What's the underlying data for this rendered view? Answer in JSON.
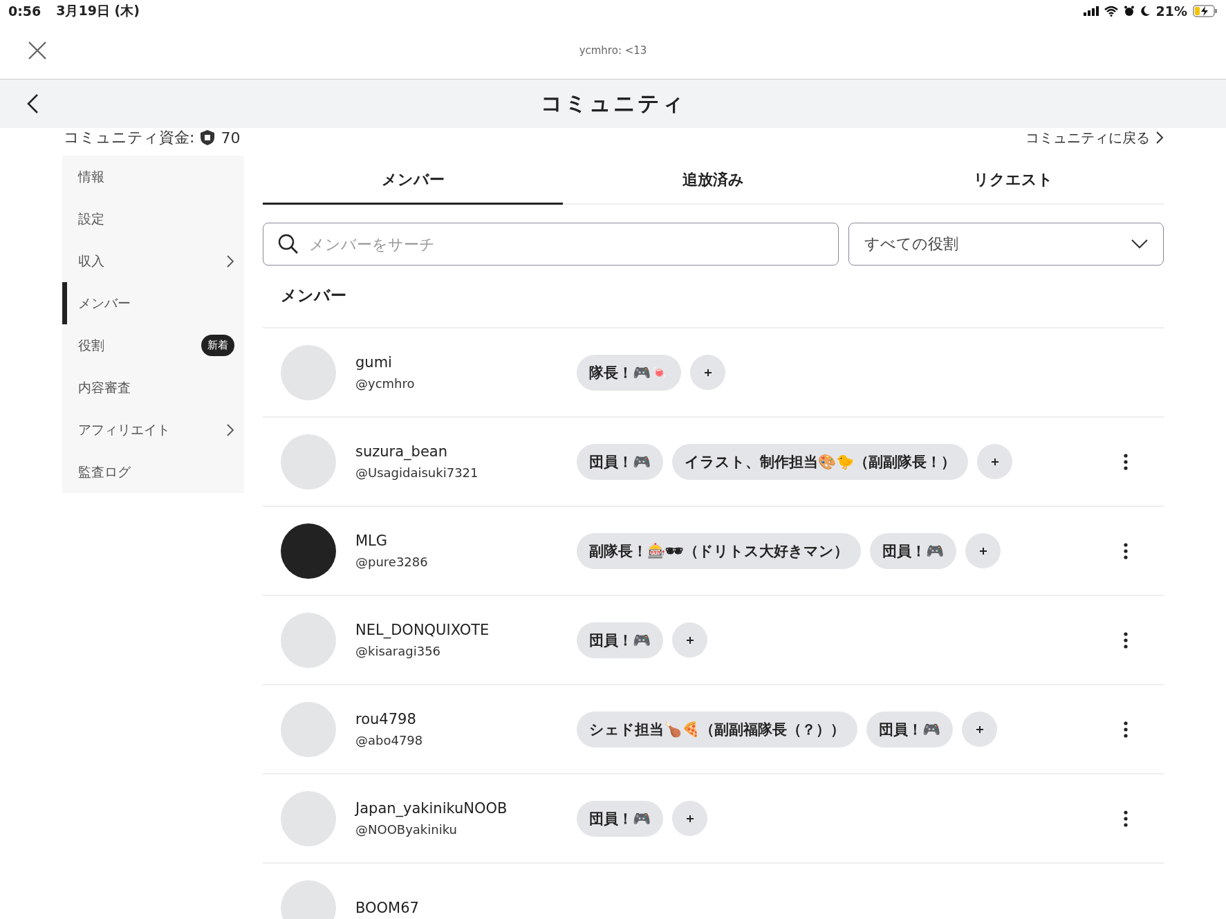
{
  "status_bar": {
    "time": "0:56",
    "date": "3月19日 (木)",
    "battery": "21%"
  },
  "top_bar": {
    "title": "ycmhro: <13"
  },
  "nav_bar": {
    "title": "コミュニティ"
  },
  "funds": {
    "label": "コミュニティ資金:",
    "amount": "70",
    "back_link": "コミュニティに戻る"
  },
  "sidebar": {
    "items": [
      {
        "label": "情報",
        "selected": false,
        "expandable": false
      },
      {
        "label": "設定",
        "selected": false,
        "expandable": false
      },
      {
        "label": "収入",
        "selected": false,
        "expandable": true
      },
      {
        "label": "メンバー",
        "selected": true,
        "expandable": false
      },
      {
        "label": "役割",
        "selected": false,
        "expandable": false,
        "badge": "新着"
      },
      {
        "label": "内容審査",
        "selected": false,
        "expandable": false
      },
      {
        "label": "アフィリエイト",
        "selected": false,
        "expandable": true
      },
      {
        "label": "監査ログ",
        "selected": false,
        "expandable": false
      }
    ]
  },
  "tabs": [
    {
      "label": "メンバー",
      "selected": true
    },
    {
      "label": "追放済み",
      "selected": false
    },
    {
      "label": "リクエスト",
      "selected": false
    }
  ],
  "search": {
    "placeholder": "メンバーをサーチ"
  },
  "role_filter": {
    "value": "すべての役割"
  },
  "section_title": "メンバー",
  "members": [
    {
      "name": "gumi",
      "handle": "@ycmhro",
      "roles": [
        "隊長！🎮🍬"
      ],
      "menu": false
    },
    {
      "name": "suzura_bean",
      "handle": "@Usagidaisuki7321",
      "roles": [
        "団員！🎮",
        "イラスト、制作担当🎨🐤（副副隊長！）"
      ],
      "menu": true
    },
    {
      "name": "MLG",
      "handle": "@pure3286",
      "roles": [
        "副隊長！🎰🕶（ドリトス大好きマン）",
        "団員！🎮"
      ],
      "menu": true
    },
    {
      "name": "NEL_DONQUIXOTE",
      "handle": "@kisaragi356",
      "roles": [
        "団員！🎮"
      ],
      "menu": true
    },
    {
      "name": "rou4798",
      "handle": "@abo4798",
      "roles": [
        "シェド担当🍗🍕（副副福隊長（？））",
        "団員！🎮"
      ],
      "menu": true
    },
    {
      "name": "Japan_yakinikuNOOB",
      "handle": "@NOOByakiniku",
      "roles": [
        "団員！🎮"
      ],
      "menu": true
    },
    {
      "name": "BOOM67",
      "menu": false
    }
  ]
}
